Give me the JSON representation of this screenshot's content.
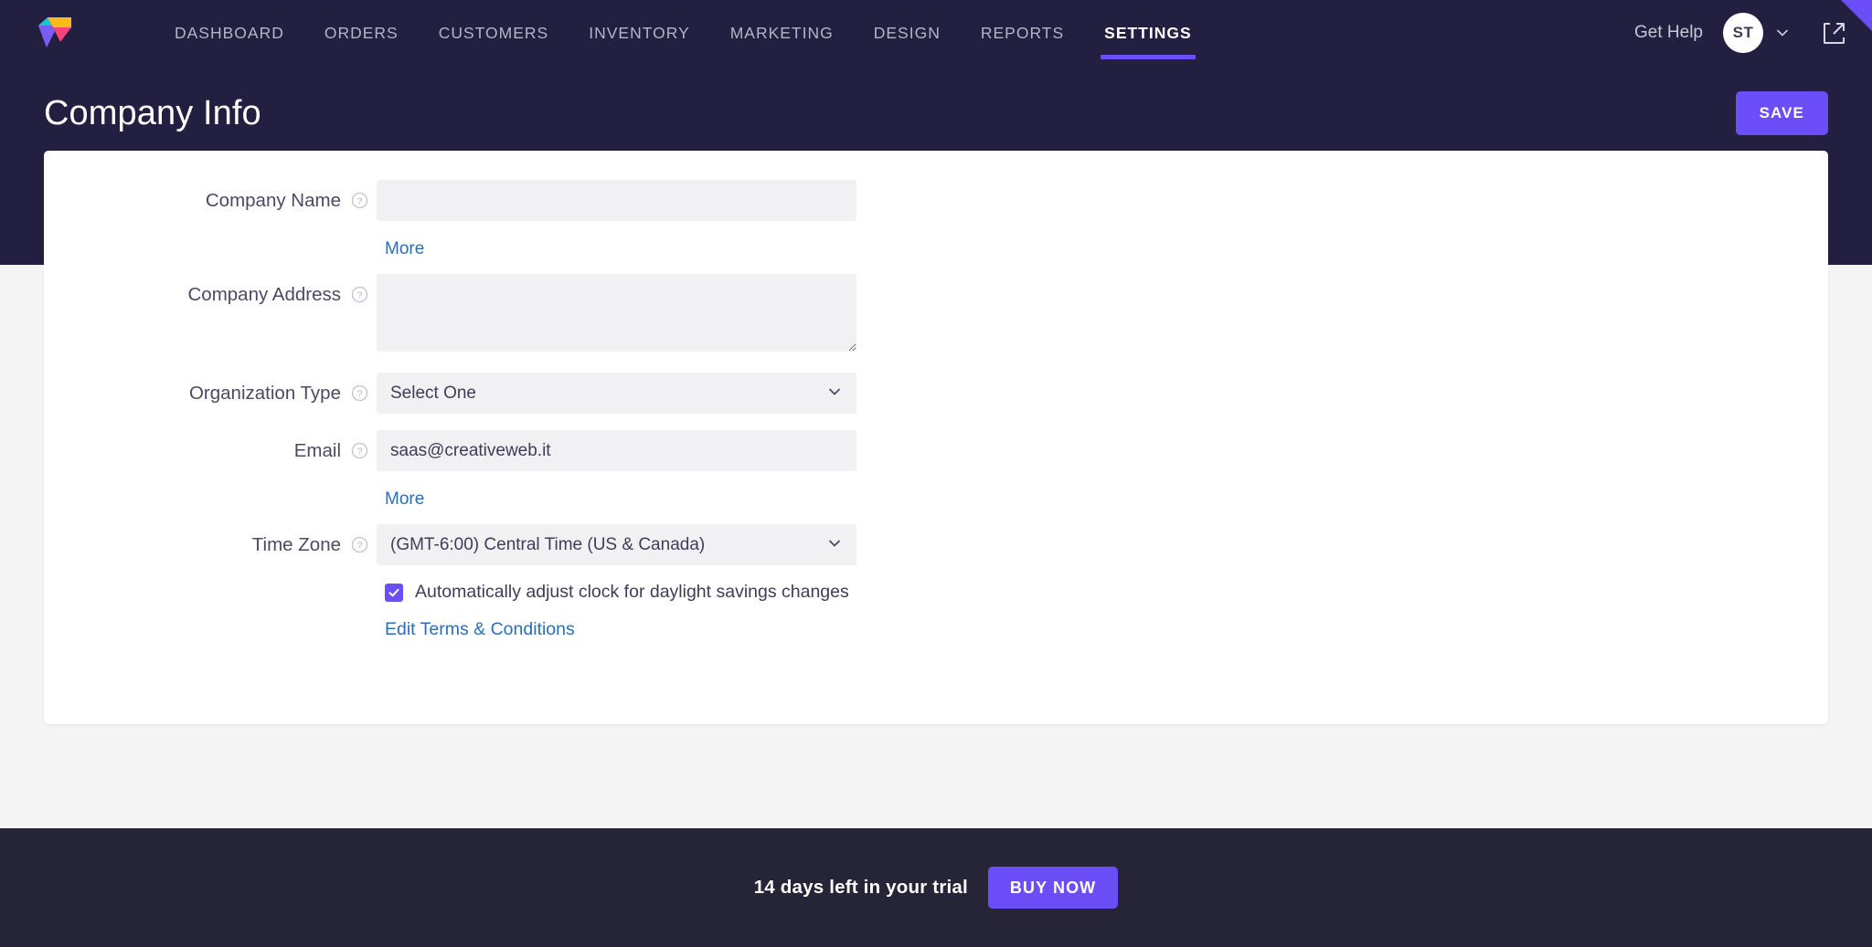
{
  "colors": {
    "header_bg": "#221f41",
    "accent": "#6b4ef7",
    "page_bg": "#f4f4f5",
    "card_bg": "#ffffff",
    "input_bg": "#f1f1f4",
    "link": "#2a6ebb",
    "footer_bg": "#262437"
  },
  "navbar": {
    "logo_name": "app-logo",
    "items": [
      {
        "label": "DASHBOARD",
        "active": false
      },
      {
        "label": "ORDERS",
        "active": false
      },
      {
        "label": "CUSTOMERS",
        "active": false
      },
      {
        "label": "INVENTORY",
        "active": false
      },
      {
        "label": "MARKETING",
        "active": false
      },
      {
        "label": "DESIGN",
        "active": false
      },
      {
        "label": "REPORTS",
        "active": false
      },
      {
        "label": "SETTINGS",
        "active": true
      }
    ],
    "get_help_label": "Get Help",
    "avatar_initials": "ST"
  },
  "header": {
    "title": "Company Info",
    "save_label": "SAVE"
  },
  "form": {
    "company_name": {
      "label": "Company Name",
      "value": "",
      "placeholder": ""
    },
    "more_link_1": "More",
    "company_address": {
      "label": "Company Address",
      "value": "",
      "placeholder": ""
    },
    "organization_type": {
      "label": "Organization Type",
      "value": "Select One"
    },
    "email": {
      "label": "Email",
      "value": "saas@creativeweb.it",
      "placeholder": ""
    },
    "more_link_2": "More",
    "time_zone": {
      "label": "Time Zone",
      "value": "(GMT-6:00) Central Time (US & Canada)"
    },
    "daylight_savings": {
      "label": "Automatically adjust clock for daylight savings changes",
      "checked": true
    },
    "terms_link": "Edit Terms & Conditions"
  },
  "footer": {
    "trial_text": "14 days left in your trial",
    "buy_label": "BUY NOW"
  }
}
